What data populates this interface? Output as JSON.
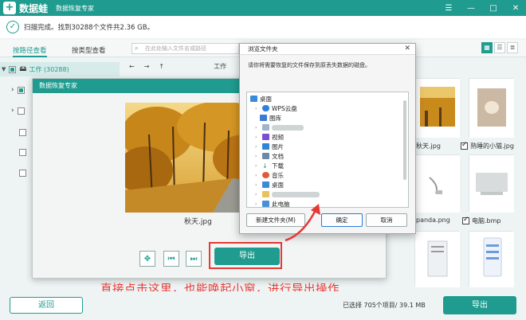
{
  "app": {
    "logo_char": "+",
    "name": "数据蛙",
    "subtitle": "数据恢复专家",
    "controls": {
      "menu": "☰",
      "minimize": "—",
      "maximize": "□",
      "close": "✕"
    }
  },
  "status": {
    "text": "扫描完成。找到30288个文件共2.36 GB。"
  },
  "tabs": {
    "by_path": "按路径查看",
    "by_type": "按类型查看"
  },
  "search": {
    "placeholder": "在此处输入文件名或路径"
  },
  "tree": {
    "root_label": "工作 (30288)"
  },
  "path": {
    "back": "←",
    "forward": "→",
    "up": "↑",
    "crumb": "工作"
  },
  "thumbnails": [
    {
      "label": "秋天.jpg",
      "checked": false
    },
    {
      "label": "熟睡的小猫.jpg",
      "checked": true
    },
    {
      "label": "panda.png",
      "checked": false
    },
    {
      "label": "电脑.bmp",
      "checked": true
    }
  ],
  "preview_modal": {
    "title": "数据恢复专家",
    "caption": "秋天.jpg",
    "export_label": "导出",
    "controls": {
      "fit": "✥",
      "prev": "⏮",
      "next": "⏭"
    }
  },
  "folder_dialog": {
    "title": "浏览文件夹",
    "close": "✕",
    "description": "请你将需要恢复的文件保存到原丢失数据的磁盘。",
    "nodes": [
      "桌面",
      "WPS云盘",
      "图库",
      "视频",
      "图片",
      "文档",
      "下载",
      "音乐",
      "桌面",
      "此电脑"
    ],
    "new_folder": "新建文件夹(M)",
    "ok": "确定",
    "cancel": "取消"
  },
  "annotation": "直接点击这里，也能唤起小窗，进行导出操作",
  "bottom": {
    "back": "返回",
    "selected_info": "已选择 705个项目/ 39.1 MB",
    "export": "导出"
  },
  "colors": {
    "brand": "#1f9c8f",
    "annotation_red": "#e53935",
    "dialog_accent": "#2b79d6"
  }
}
